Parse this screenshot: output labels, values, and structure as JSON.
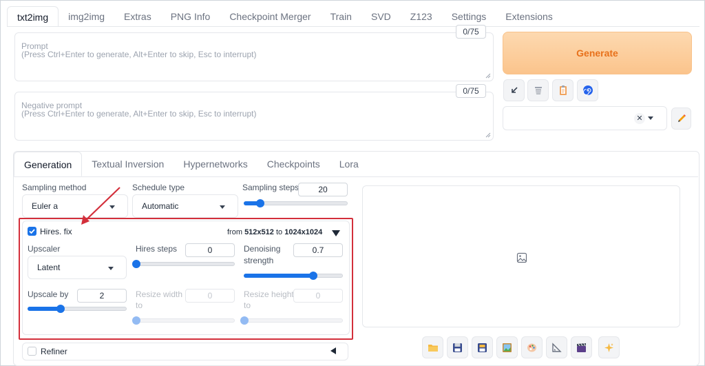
{
  "top_tabs": [
    "txt2img",
    "img2img",
    "Extras",
    "PNG Info",
    "Checkpoint Merger",
    "Train",
    "SVD",
    "Z123",
    "Settings",
    "Extensions"
  ],
  "prompt": {
    "label": "Prompt",
    "placeholder": "(Press Ctrl+Enter to generate, Alt+Enter to skip, Esc to interrupt)",
    "counter": "0/75"
  },
  "negative_prompt": {
    "label": "Negative prompt",
    "placeholder": "(Press Ctrl+Enter to generate, Alt+Enter to skip, Esc to interrupt)",
    "counter": "0/75"
  },
  "generate_label": "Generate",
  "styles_dropdown": {
    "value": ""
  },
  "sub_tabs": [
    "Generation",
    "Textual Inversion",
    "Hypernetworks",
    "Checkpoints",
    "Lora"
  ],
  "sampling": {
    "method_label": "Sampling method",
    "method_value": "Euler a",
    "schedule_label": "Schedule type",
    "schedule_value": "Automatic",
    "steps_label": "Sampling steps",
    "steps_value": "20",
    "steps_fraction": 0.16
  },
  "hires": {
    "checkbox_label": "Hires. fix",
    "checked": true,
    "from_prefix": "from",
    "from_size": "512x512",
    "to_prefix": "to",
    "to_size": "1024x1024",
    "upscaler_label": "Upscaler",
    "upscaler_value": "Latent",
    "steps_label": "Hires steps",
    "steps_value": "0",
    "steps_fraction": 0.0,
    "denoise_label_1": "Denoising",
    "denoise_label_2": "strength",
    "denoise_value": "0.7",
    "denoise_fraction": 0.7,
    "upscale_label": "Upscale by",
    "upscale_value": "2",
    "upscale_fraction": 0.33,
    "width_label_1": "Resize width",
    "width_label_2": "to",
    "width_value": "0",
    "height_label_1": "Resize height",
    "height_label_2": "to",
    "height_value": "0"
  },
  "refiner": {
    "label": "Refiner",
    "checked": false
  },
  "colors": {
    "accent": "#1a73e8",
    "generate_text": "#e8711b",
    "highlight": "#d32f3b"
  },
  "icons": {
    "tool_buttons": [
      "arrow-icon",
      "trash-icon",
      "clipboard-icon",
      "spiral-icon"
    ],
    "bottom_buttons": [
      "folder-icon",
      "save-icon",
      "zip-icon",
      "image-icon",
      "palette-icon",
      "ruler-icon",
      "video-icon",
      "sparkle-icon"
    ]
  }
}
